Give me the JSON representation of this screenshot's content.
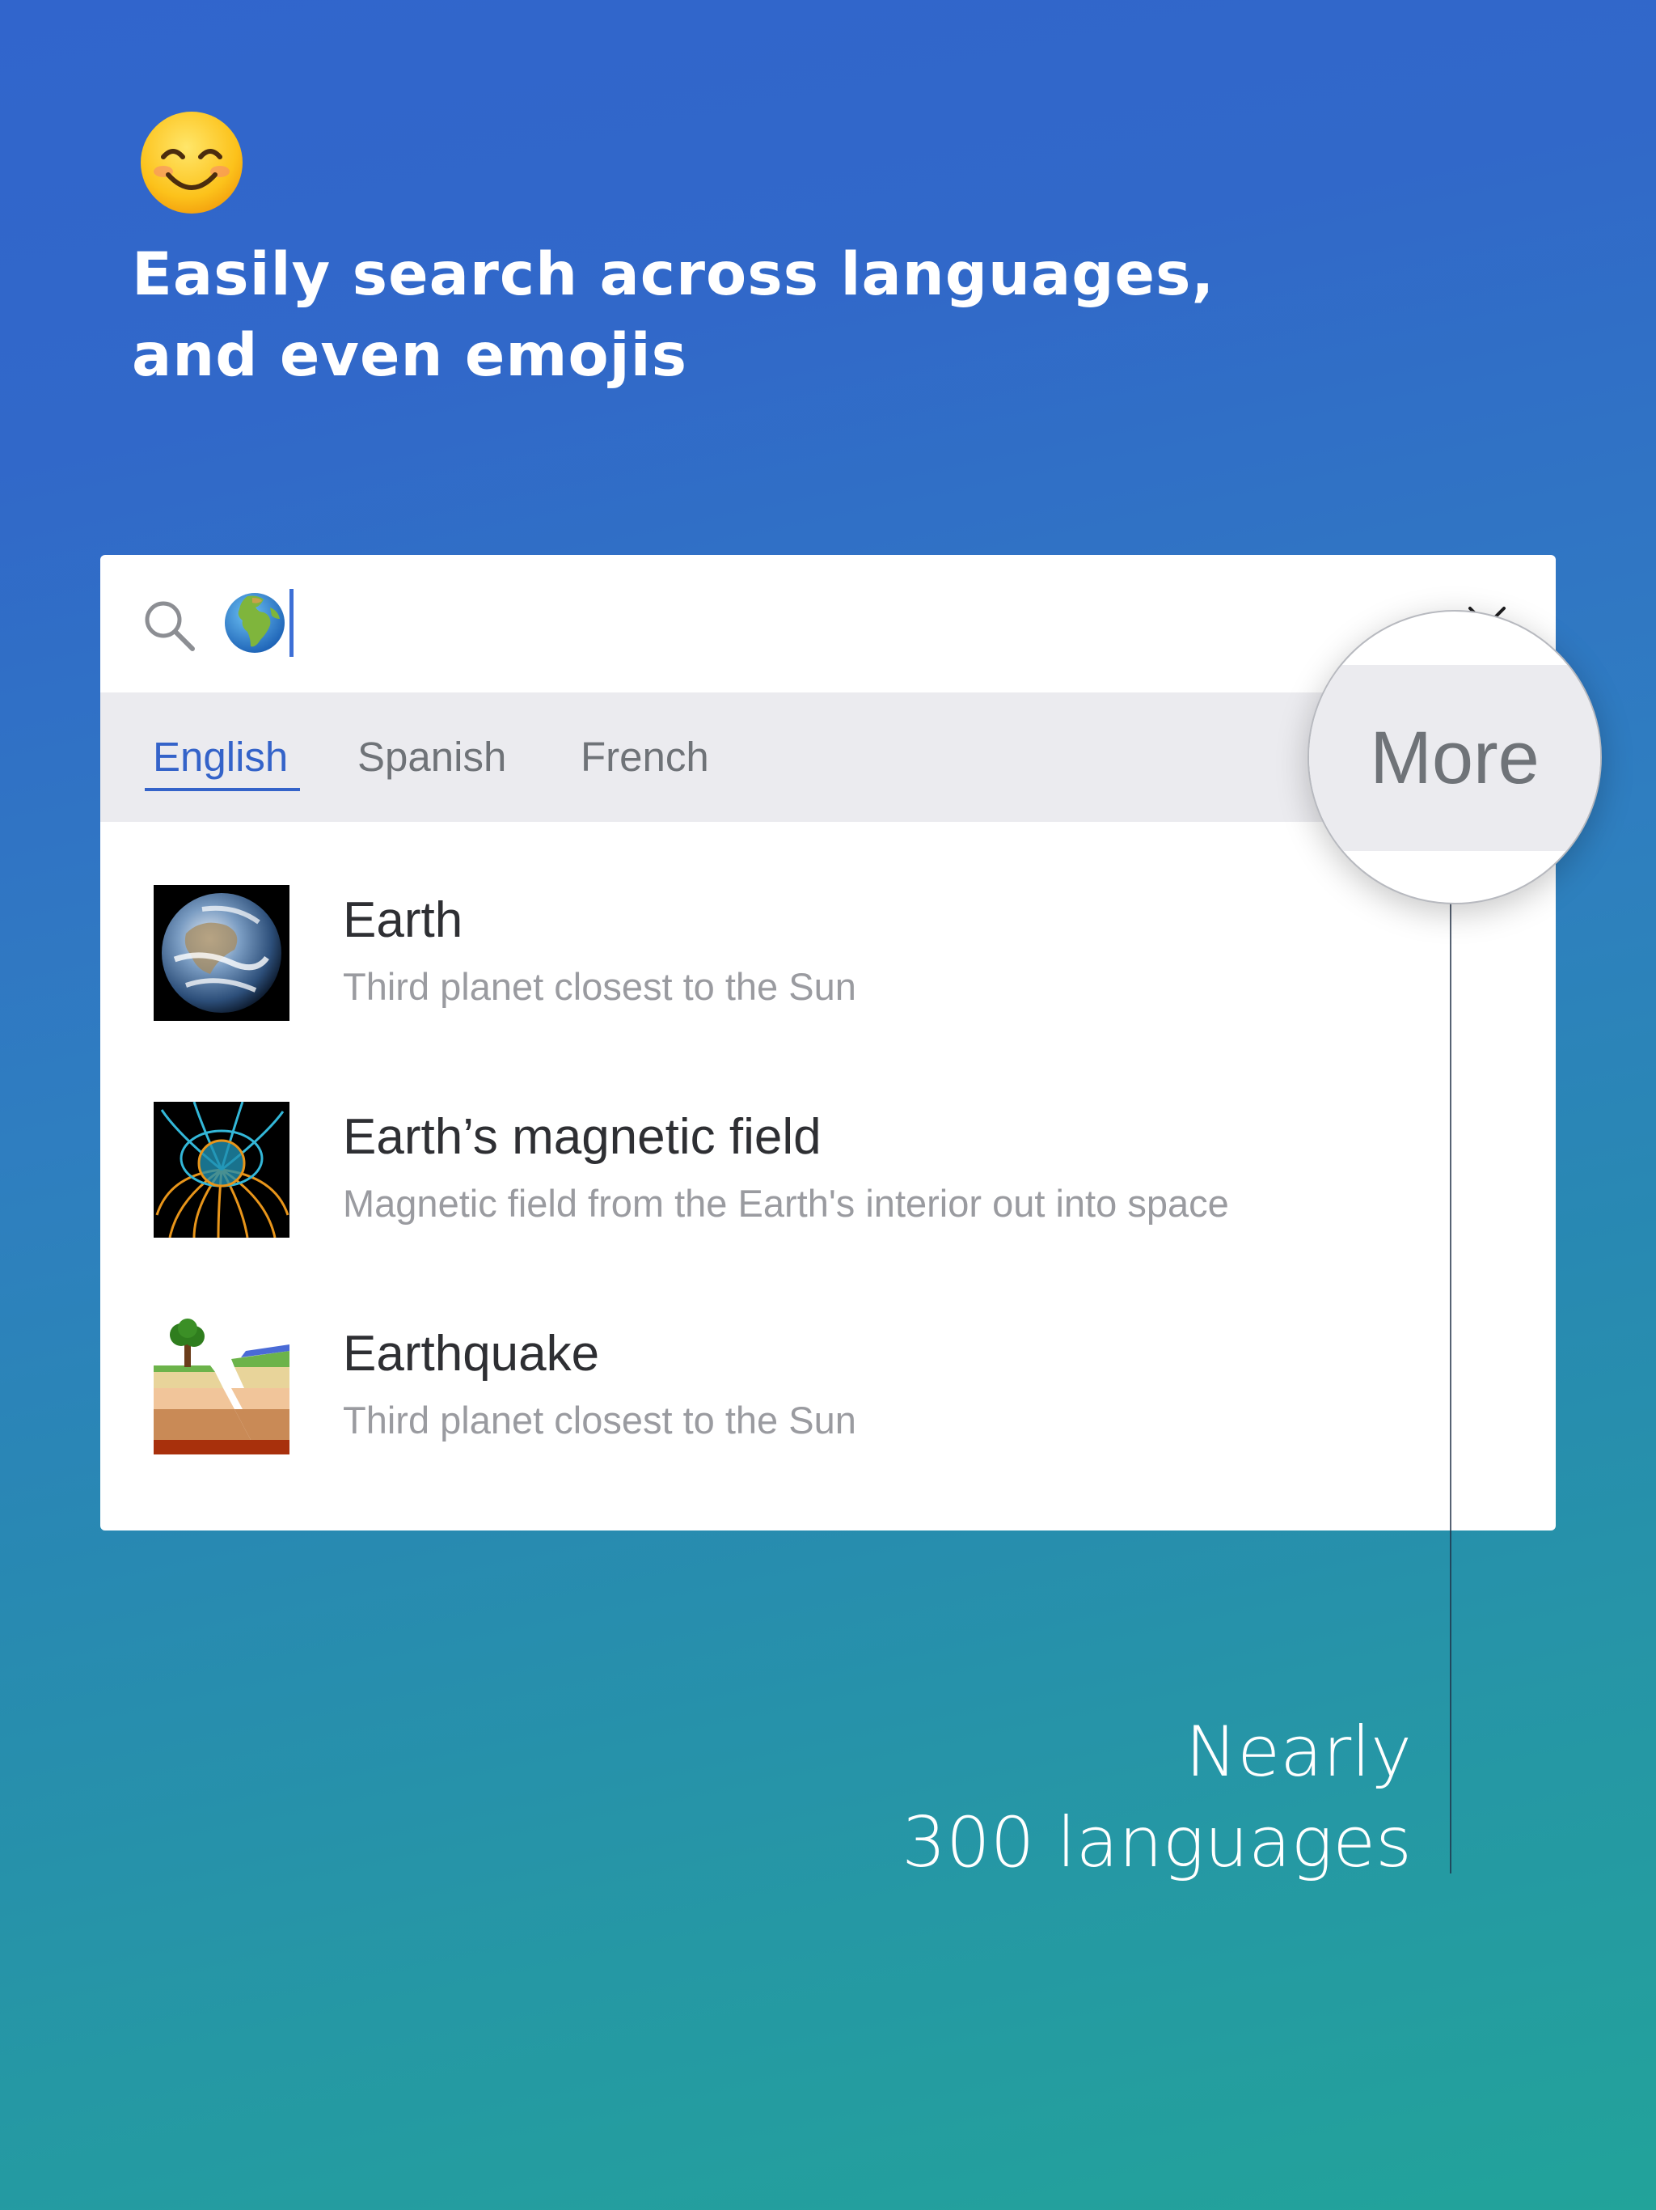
{
  "hero": {
    "emoji": "smiling-face-with-smiling-eyes",
    "headline_line1": "Easily search across languages,",
    "headline_line2": "and even emojis"
  },
  "search": {
    "icon": "search-icon",
    "query_emoji": "globe-showing-europe-africa",
    "clear_icon": "close-icon"
  },
  "languages": {
    "tabs": [
      {
        "label": "English",
        "active": true
      },
      {
        "label": "Spanish",
        "active": false
      },
      {
        "label": "French",
        "active": false
      }
    ],
    "more_label": "More"
  },
  "results": [
    {
      "title": "Earth",
      "description": "Third planet closest to the Sun",
      "thumbnail": "earth-photo"
    },
    {
      "title": "Earth’s magnetic field",
      "description": "Magnetic field from the Earth's interior out into space",
      "thumbnail": "magnetic-field-illustration"
    },
    {
      "title": "Earthquake",
      "description": "Third planet closest to the Sun",
      "thumbnail": "earthquake-diagram"
    }
  ],
  "callout": {
    "line1": "Nearly",
    "line2": "300 languages"
  },
  "colors": {
    "accent": "#3463c9",
    "background_top": "#3165cc",
    "background_bottom": "#22a39a"
  }
}
